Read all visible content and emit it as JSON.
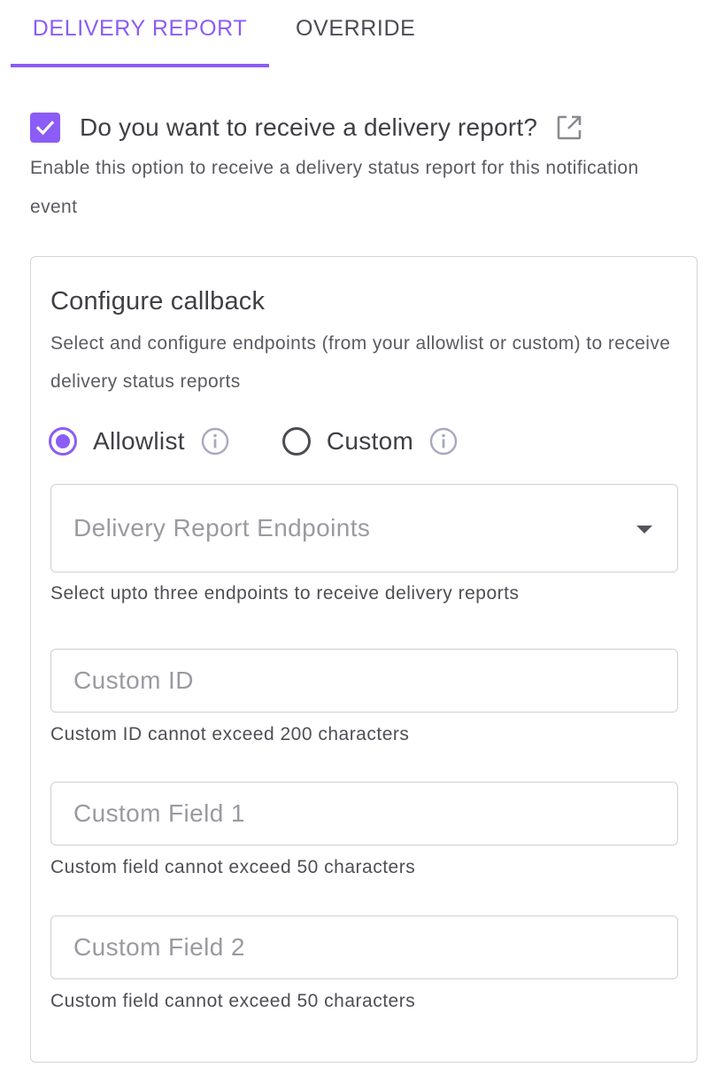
{
  "tabs": [
    {
      "label": "DELIVERY REPORT",
      "active": true
    },
    {
      "label": "OVERRIDE",
      "active": false
    }
  ],
  "delivery_report": {
    "checked": true,
    "question": "Do you want to receive a delivery report?",
    "description": "Enable this option to receive a delivery status report for this notification event",
    "icon": "external-link-icon"
  },
  "callback": {
    "title": "Configure callback",
    "description": "Select and configure endpoints (from your allowlist or custom) to receive delivery status reports",
    "radio_options": [
      {
        "label": "Allowlist",
        "selected": true,
        "icon": "info-icon"
      },
      {
        "label": "Custom",
        "selected": false,
        "icon": "info-icon"
      }
    ],
    "endpoints_select": {
      "placeholder": "Delivery Report Endpoints",
      "helper": "Select upto three endpoints to receive delivery reports",
      "icon": "chevron-down-icon"
    },
    "custom_id": {
      "placeholder": "Custom ID",
      "helper": "Custom ID cannot exceed 200 characters"
    },
    "custom_field_1": {
      "placeholder": "Custom Field 1",
      "helper": "Custom field cannot exceed 50 characters"
    },
    "custom_field_2": {
      "placeholder": "Custom Field 2",
      "helper": "Custom field cannot exceed 50 characters"
    }
  },
  "colors": {
    "accent": "#8b5cf6",
    "text": "#3f3f46",
    "border": "#d4d4d8"
  }
}
